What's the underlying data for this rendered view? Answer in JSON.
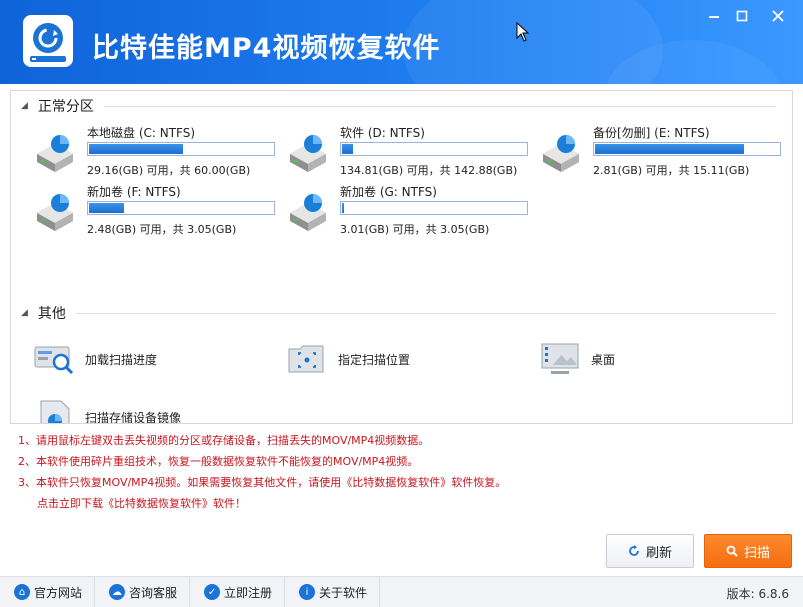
{
  "app": {
    "title": "比特佳能MP4视频恢复软件"
  },
  "window": {
    "minimize_glyph": "—",
    "maximize_glyph": "☐",
    "close_glyph": "✕"
  },
  "partitions": {
    "heading": "正常分区",
    "drives": [
      {
        "name": "本地磁盘 (C: NTFS)",
        "info": "29.16(GB) 可用，共 60.00(GB)",
        "used_fraction": 0.51
      },
      {
        "name": "软件 (D: NTFS)",
        "info": "134.81(GB) 可用，共 142.88(GB)",
        "used_fraction": 0.06
      },
      {
        "name": "备份[勿删] (E: NTFS)",
        "info": "2.81(GB) 可用，共 15.11(GB)",
        "used_fraction": 0.81
      },
      {
        "name": "新加卷 (F: NTFS)",
        "info": "2.48(GB) 可用，共 3.05(GB)",
        "used_fraction": 0.19
      },
      {
        "name": "新加卷 (G: NTFS)",
        "info": "3.01(GB) 可用，共 3.05(GB)",
        "used_fraction": 0.01
      }
    ]
  },
  "others": {
    "heading": "其他",
    "items": [
      {
        "label": "加载扫描进度",
        "icon": "load-progress-icon"
      },
      {
        "label": "指定扫描位置",
        "icon": "scan-location-icon"
      },
      {
        "label": "桌面",
        "icon": "desktop-icon"
      },
      {
        "label": "扫描存储设备镜像",
        "icon": "disk-image-icon"
      }
    ]
  },
  "notes": [
    "1、请用鼠标左键双击丢失视频的分区或存储设备，扫描丢失的MOV/MP4视频数据。",
    "2、本软件使用碎片重组技术，恢复一般数据恢复软件不能恢复的MOV/MP4视频。",
    "3、本软件只恢复MOV/MP4视频。如果需要恢复其他文件，请使用《比特数据恢复软件》软件恢复。",
    "点击立即下载《比特数据恢复软件》软件！"
  ],
  "buttons": {
    "refresh": "刷新",
    "scan": "扫描"
  },
  "footer": {
    "items": [
      "官方网站",
      "咨询客服",
      "立即注册",
      "关于软件"
    ],
    "version": "版本: 6.8.6"
  },
  "colors": {
    "header_blue": "#1f7ef0",
    "bar_blue": "#1d6fd0",
    "scan_orange": "#f46d0f",
    "note_red": "#c8161d"
  }
}
